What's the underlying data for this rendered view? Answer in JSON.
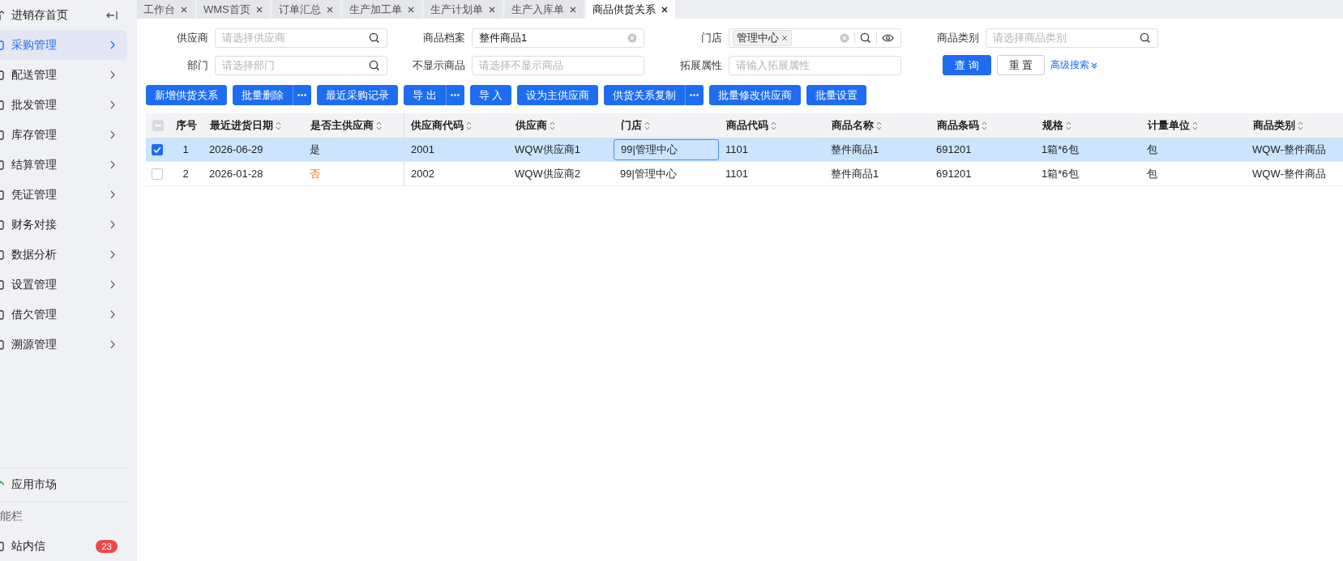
{
  "sidebar": {
    "home": {
      "label": "进销存首页"
    },
    "items": [
      {
        "label": "采购管理",
        "selected": true
      },
      {
        "label": "配送管理",
        "selected": false
      },
      {
        "label": "批发管理",
        "selected": false
      },
      {
        "label": "库存管理",
        "selected": false
      },
      {
        "label": "结算管理",
        "selected": false
      },
      {
        "label": "凭证管理",
        "selected": false
      },
      {
        "label": "财务对接",
        "selected": false
      },
      {
        "label": "数据分析",
        "selected": false
      },
      {
        "label": "设置管理",
        "selected": false
      },
      {
        "label": "借欠管理",
        "selected": false
      },
      {
        "label": "溯源管理",
        "selected": false
      }
    ],
    "app_market": {
      "label": "应用市场"
    },
    "section_label": "能栏",
    "messages": {
      "label": "站内信",
      "badge": "23"
    }
  },
  "tabs": [
    {
      "label": "工作台",
      "selected": false
    },
    {
      "label": "WMS首页",
      "selected": false
    },
    {
      "label": "订单汇总",
      "selected": false
    },
    {
      "label": "生产加工单",
      "selected": false
    },
    {
      "label": "生产计划单",
      "selected": false
    },
    {
      "label": "生产入库单",
      "selected": false
    },
    {
      "label": "商品供货关系",
      "selected": true
    }
  ],
  "filters": [
    {
      "label": "供应商",
      "kind": "search",
      "placeholder": "请选择供应商"
    },
    {
      "label": "商品档案",
      "kind": "clear",
      "value": "整件商品1"
    },
    {
      "label": "门店",
      "kind": "tags",
      "tags": [
        "管理中心"
      ]
    },
    {
      "label": "商品类别",
      "kind": "search",
      "placeholder": "请选择商品类别"
    },
    {
      "label": "部门",
      "kind": "search",
      "placeholder": "请选择部门"
    },
    {
      "label": "不显示商品",
      "kind": "plain",
      "placeholder": "请选择不显示商品"
    },
    {
      "label": "拓展属性",
      "kind": "plain",
      "placeholder": "请输入拓展属性"
    }
  ],
  "query_button": "查 询",
  "reset_button": "重 置",
  "advanced_search": "高级搜索",
  "toolbar": [
    {
      "label": "新增供货关系",
      "split": false
    },
    {
      "label": "批量删除",
      "split": true
    },
    {
      "label": "最近采购记录",
      "split": false
    },
    {
      "label": "导 出",
      "split": true
    },
    {
      "label": "导 入",
      "split": false
    },
    {
      "label": "设为主供应商",
      "split": false
    },
    {
      "label": "供货关系复制",
      "split": true
    },
    {
      "label": "批量修改供应商",
      "split": false
    },
    {
      "label": "批量设置",
      "split": false
    }
  ],
  "table": {
    "header_checkbox": {
      "partial": true
    },
    "columns": [
      "序号",
      "最近进货日期",
      "是否主供应商",
      "供应商代码",
      "供应商",
      "门店",
      "商品代码",
      "商品名称",
      "商品条码",
      "规格",
      "计量单位",
      "商品类别"
    ],
    "rows": [
      {
        "selected": true,
        "main_supplier": true,
        "store_focused": true,
        "cells": [
          "1",
          "2026-06-29",
          "是",
          "2001",
          "WQW供应商1",
          "99|管理中心",
          "1101",
          "整件商品1",
          "691201",
          "1箱*6包",
          "包",
          "WQW-整件商品"
        ]
      },
      {
        "selected": false,
        "main_supplier": false,
        "store_focused": false,
        "cells": [
          "2",
          "2026-01-28",
          "否",
          "2002",
          "WQW供应商2",
          "99|管理中心",
          "1101",
          "整件商品1",
          "691201",
          "1箱*6包",
          "包",
          "WQW-整件商品"
        ]
      }
    ]
  }
}
